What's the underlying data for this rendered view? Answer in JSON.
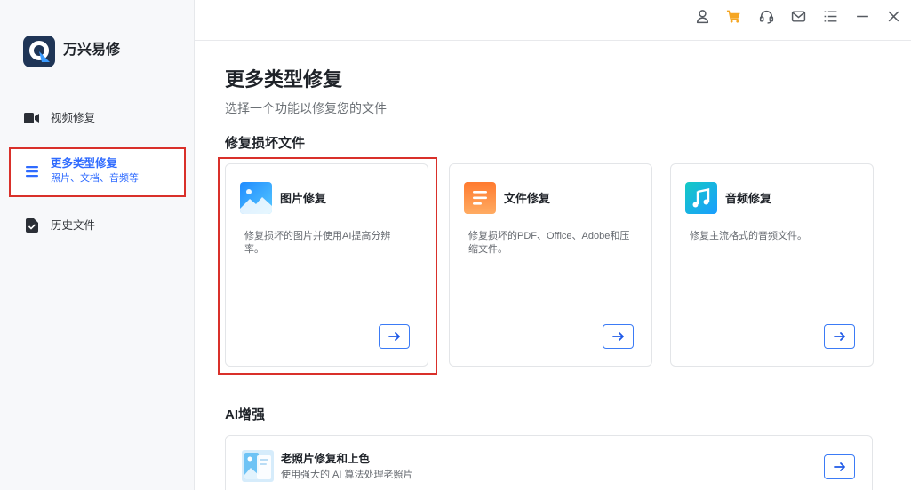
{
  "app": {
    "name": "万兴易修",
    "logo_icon": "app-logo-icon"
  },
  "sidebar": {
    "items": [
      {
        "label": "视频修复",
        "icon": "video-icon"
      },
      {
        "label": "更多类型修复",
        "sublabel": "照片、文档、音频等",
        "icon": "list-icon"
      },
      {
        "label": "历史文件",
        "icon": "file-check-icon"
      }
    ],
    "selected_index": 1
  },
  "titlebar": {
    "icons": [
      "user-icon",
      "cart-icon",
      "headset-icon",
      "mail-icon",
      "menu-icon",
      "minimize-icon",
      "close-icon"
    ]
  },
  "main": {
    "title": "更多类型修复",
    "subtitle": "选择一个功能以修复您的文件",
    "repair_section": {
      "heading": "修复损坏文件",
      "cards": [
        {
          "title": "图片修复",
          "description": "修复损坏的图片并使用AI提高分辨率。",
          "icon": "image-icon",
          "action_icon": "arrow-right-icon"
        },
        {
          "title": "文件修复",
          "description": "修复损坏的PDF、Office、Adobe和压缩文件。",
          "icon": "document-icon",
          "action_icon": "arrow-right-icon"
        },
        {
          "title": "音频修复",
          "description": "修复主流格式的音频文件。",
          "icon": "music-icon",
          "action_icon": "arrow-right-icon"
        }
      ]
    },
    "ai_section": {
      "heading": "AI增强",
      "cards": [
        {
          "title": "老照片修复和上色",
          "description": "使用强大的 AI 算法处理老照片",
          "icon": "old-photo-icon",
          "action_icon": "arrow-right-icon"
        }
      ]
    }
  },
  "colors": {
    "accent": "#2f6bff",
    "annotation_red": "#d9302a",
    "cart_orange": "#f5a623",
    "sidebar_bg": "#f7f8fa"
  }
}
